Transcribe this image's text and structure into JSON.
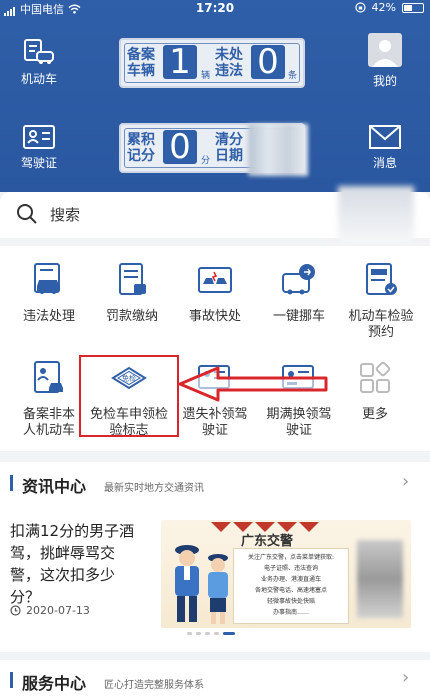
{
  "status_bar": {
    "carrier": "中国电信",
    "time": "17:20",
    "battery": "42%"
  },
  "header": {
    "vehicle_label": "机动车",
    "license_label": "驾驶证",
    "profile_label": "我的",
    "message_label": "消息",
    "plate1": {
      "left_label_1": "备案",
      "left_label_2": "车辆",
      "value1": "1",
      "unit1": "辆",
      "right_label_1": "未处",
      "right_label_2": "违法",
      "value2": "0",
      "unit2": "条"
    },
    "plate2": {
      "left_label_1": "累积",
      "left_label_2": "记分",
      "value1": "0",
      "unit1": "分",
      "right_label_1": "清分",
      "right_label_2": "日期"
    }
  },
  "search": {
    "placeholder": "搜索"
  },
  "services": [
    {
      "label": "违法处理"
    },
    {
      "label": "罚款缴纳"
    },
    {
      "label": "事故快处"
    },
    {
      "label": "一键挪车"
    },
    {
      "label": "机动车检验预约"
    },
    {
      "label": "备案非本人机动车"
    },
    {
      "label": "免检车申领检验标志"
    },
    {
      "label": "遗失补领驾驶证"
    },
    {
      "label": "期满换领驾驶证"
    },
    {
      "label": "更多"
    }
  ],
  "icon_badges": {
    "exempt": "免检"
  },
  "news": {
    "section_title": "资讯中心",
    "section_subtitle": "最新实时地方交通资讯",
    "title": "扣满12分的男子酒驾，挑衅辱骂交警，这次扣多少分？",
    "date": "2020-07-13",
    "banner_title": "广东交警",
    "banner_lines": [
      "关注广东交警，点击菜单键获取:",
      "电子证照、违法查询",
      "业务办理、港澳直通车",
      "各地交警电话、高速堵塞点",
      "轻微事故快处快赔",
      "办事指南……"
    ]
  },
  "service_center": {
    "title": "服务中心",
    "subtitle": "匠心打造完整服务体系"
  },
  "colors": {
    "brand": "#2f5fa8",
    "highlight": "#d9262b"
  }
}
